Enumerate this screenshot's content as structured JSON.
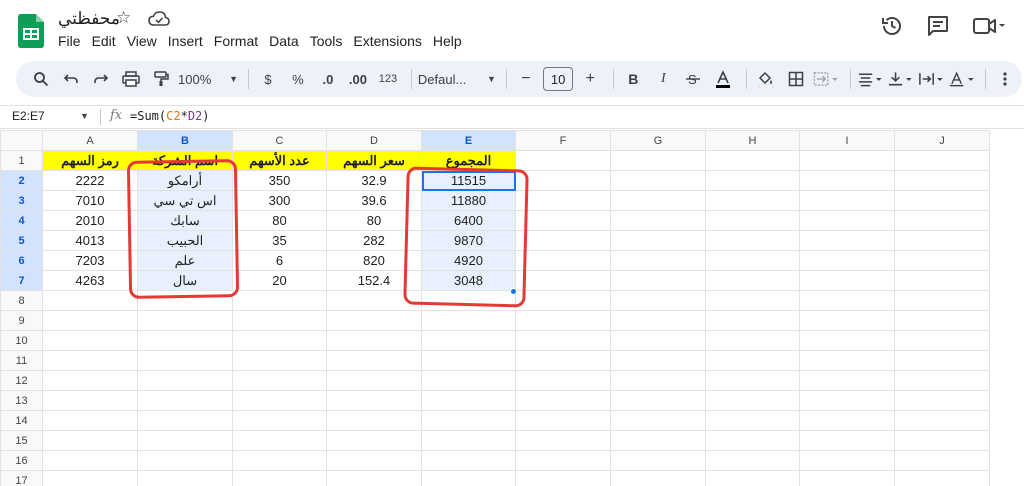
{
  "app": {
    "doc_title": "محفظتي",
    "menu": [
      "File",
      "Edit",
      "View",
      "Insert",
      "Format",
      "Data",
      "Tools",
      "Extensions",
      "Help"
    ]
  },
  "toolbar": {
    "zoom": "100%",
    "currency": "$",
    "percent": "%",
    "dec_decrease": ".0",
    "dec_increase": ".00",
    "number_format": "123",
    "font": "Defaul...",
    "minus": "−",
    "font_size": "10",
    "plus": "+",
    "bold": "B",
    "italic": "I"
  },
  "formula_bar": {
    "name_box": "E2:E7",
    "fx": "fx",
    "formula_prefix": "=Sum(",
    "ref1": "C2",
    "op": "*",
    "ref2": "D2",
    "formula_suffix": ")"
  },
  "sheet": {
    "columns": [
      "A",
      "B",
      "C",
      "D",
      "E",
      "F",
      "G",
      "H",
      "I",
      "J"
    ],
    "rows": [
      "1",
      "2",
      "3",
      "4",
      "5",
      "6",
      "7",
      "8",
      "9",
      "10",
      "11",
      "12",
      "13",
      "14",
      "15",
      "16",
      "17"
    ],
    "header": [
      "رمز السهم",
      "اسم الشركة",
      "عدد الأسهم",
      "سعر السهم",
      "المجموع"
    ],
    "data": [
      [
        "2222",
        "أرامكو",
        "350",
        "32.9",
        "11515"
      ],
      [
        "7010",
        "اس تي سي",
        "300",
        "39.6",
        "11880"
      ],
      [
        "2010",
        "سابك",
        "80",
        "80",
        "6400"
      ],
      [
        "4013",
        "الحبيب",
        "35",
        "282",
        "9870"
      ],
      [
        "7203",
        "علم",
        "6",
        "820",
        "4920"
      ],
      [
        "4263",
        "سال",
        "20",
        "152.4",
        "3048"
      ]
    ]
  },
  "colors": {
    "header_fill": "#ffff00",
    "selection_fill": "#e8f0fe",
    "selection_border": "#1a73e8",
    "annotation": "#e53935"
  }
}
